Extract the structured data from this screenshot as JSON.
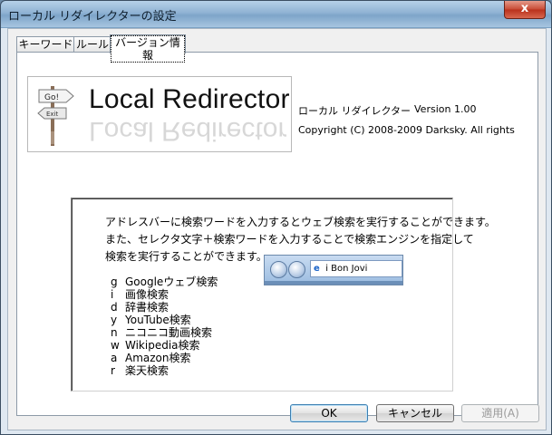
{
  "window": {
    "title": "ローカル リダイレクターの設定",
    "close_label": "x"
  },
  "tabs": [
    {
      "label": "キーワード"
    },
    {
      "label": "ルール"
    },
    {
      "label": "バージョン情報"
    }
  ],
  "about": {
    "logo_text": "Local Redirector",
    "logo_sign_go": "Go!",
    "logo_sign_exit": "Exit",
    "app_name": "ローカル リダイレクター",
    "version": "Version 1.00",
    "copyright": "Copyright (C) 2008-2009 Darksky. All rights"
  },
  "help": {
    "lines": [
      "アドレスバーに検索ワードを入力するとウェブ検索を実行することができます。",
      "また、セレクタ文字＋検索ワードを入力することで検索エンジンを指定して",
      "検索を実行することができます。"
    ],
    "engines": [
      {
        "key": "g",
        "name": "Googleウェブ検索"
      },
      {
        "key": "i",
        "name": "画像検索"
      },
      {
        "key": "d",
        "name": "辞書検索"
      },
      {
        "key": "y",
        "name": "YouTube検索"
      },
      {
        "key": "n",
        "name": "ニコニコ動画検索"
      },
      {
        "key": "w",
        "name": "Wikipedia検索"
      },
      {
        "key": "a",
        "name": "Amazon検索"
      },
      {
        "key": "r",
        "name": "楽天検索"
      }
    ],
    "browser_address": "i Bon Jovi"
  },
  "buttons": {
    "ok": "OK",
    "cancel": "キャンセル",
    "apply": "適用(A)"
  }
}
